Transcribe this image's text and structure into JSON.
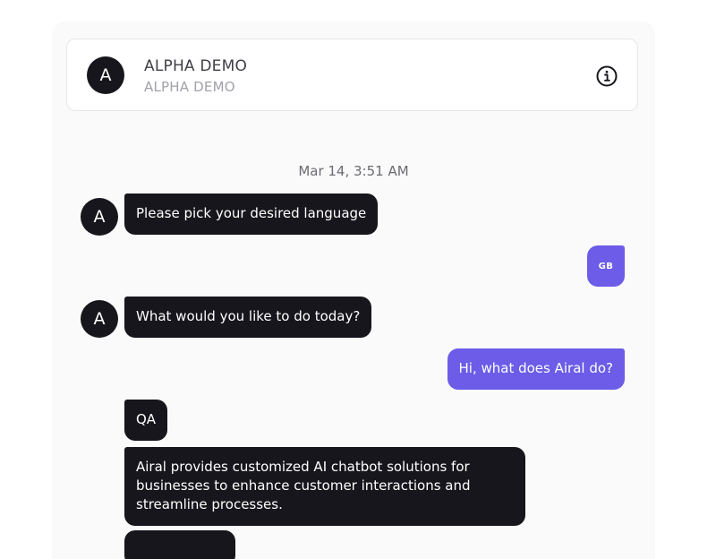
{
  "header": {
    "avatar_letter": "A",
    "title": "ALPHA DEMO",
    "subtitle": "ALPHA DEMO",
    "info_icon": "info-icon"
  },
  "timestamp": "Mar 14, 3:51 AM",
  "messages": [
    {
      "from": "bot",
      "avatar": "A",
      "text": "Please pick your desired language"
    },
    {
      "from": "user",
      "text": "GB"
    },
    {
      "from": "bot",
      "avatar": "A",
      "text": "What would you like to do today?"
    },
    {
      "from": "user",
      "text": "Hi, what does Airal do?"
    },
    {
      "from": "bot",
      "text": "QA"
    },
    {
      "from": "bot",
      "text": "Airal provides customized AI chatbot solutions for businesses to enhance customer interactions and streamline processes."
    }
  ],
  "colors": {
    "bot_bubble": "#17161c",
    "user_bubble": "#6c5ce7",
    "panel_bg": "#fafafa"
  }
}
